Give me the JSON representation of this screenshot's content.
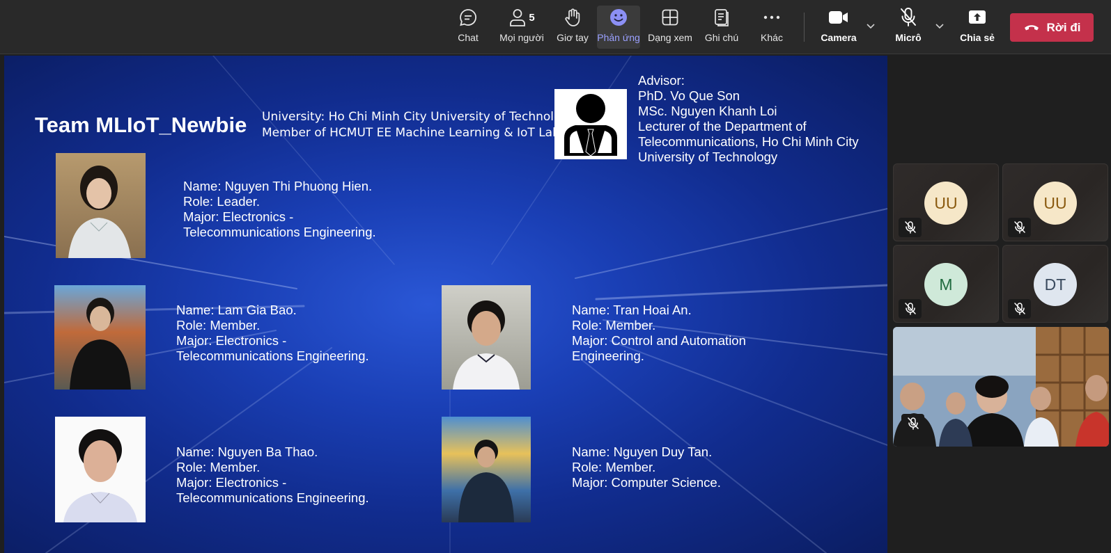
{
  "toolbar": {
    "chat": "Chat",
    "people": "Mọi người",
    "people_count": "5",
    "raise_hand": "Giơ tay",
    "react": "Phản ứng",
    "view": "Dạng xem",
    "notes": "Ghi chú",
    "more": "Khác",
    "camera": "Camera",
    "mic": "Micrô",
    "share": "Chia sẻ",
    "leave": "Rời đi"
  },
  "slide": {
    "team_title": "Team MLIoT_Newbie",
    "university_line1": "University: Ho Chi Minh City University of Technology",
    "university_line2": "Member of HCMUT EE Machine Learning & IoT Lab",
    "advisor": [
      "Advisor:",
      "PhD. Vo Que Son",
      "MSc. Nguyen Khanh Loi",
      "Lecturer of the Department of",
      "Telecommunications, Ho Chi Minh City",
      "University of Technology"
    ],
    "members": [
      [
        "Name: Nguyen Thi Phuong Hien.",
        "Role: Leader.",
        "Major: Electronics -",
        "Telecommunications Engineering."
      ],
      [
        "Name: Lam Gia Bao.",
        "Role: Member.",
        "Major: Electronics -",
        "Telecommunications Engineering."
      ],
      [
        "Name: Tran Hoai An.",
        "Role: Member.",
        "Major: Control and Automation",
        "Engineering."
      ],
      [
        "Name: Nguyen Ba Thao.",
        "Role: Member.",
        "Major: Electronics -",
        "Telecommunications Engineering."
      ],
      [
        "Name: Nguyen Duy Tan.",
        "Role: Member.",
        "Major: Computer Science."
      ]
    ]
  },
  "participants": [
    {
      "initials": "UU",
      "avatar_bg": "#f6e7c8",
      "avatar_fg": "#8a5a0f"
    },
    {
      "initials": "UU",
      "avatar_bg": "#f6e7c8",
      "avatar_fg": "#8a5a0f"
    },
    {
      "initials": "M",
      "avatar_bg": "#cfe9d9",
      "avatar_fg": "#1f6a3e"
    },
    {
      "initials": "DT",
      "avatar_bg": "#dfe6ef",
      "avatar_fg": "#3a4a5e"
    }
  ],
  "colors": {
    "leave": "#c4314b",
    "active_accent": "#9aa0ff",
    "slide_base": "#1a3fb5"
  }
}
